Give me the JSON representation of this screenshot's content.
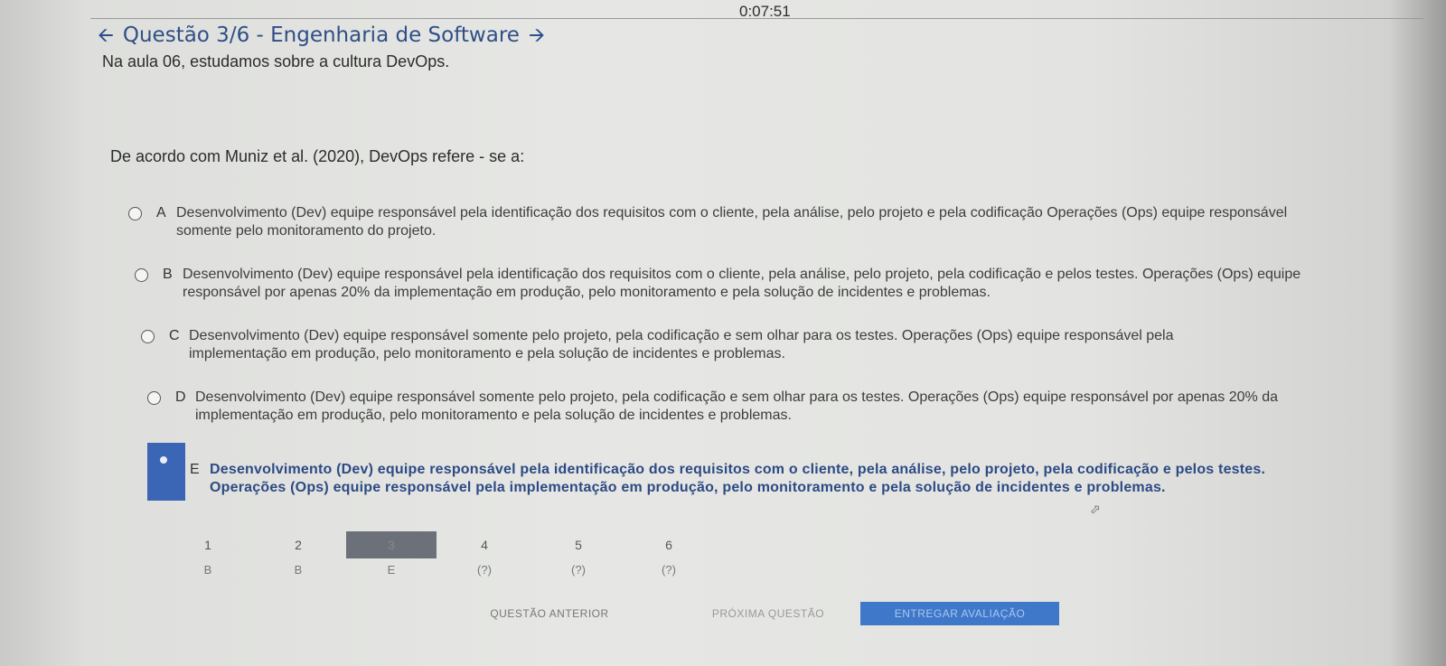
{
  "timer": "0:07:51",
  "header": {
    "title": "Questão 3/6 - Engenharia de Software",
    "prev_arrow_icon": "arrow-left-icon",
    "next_arrow_icon": "arrow-right-icon"
  },
  "intro": "Na aula 06, estudamos sobre a cultura DevOps.",
  "question": "De acordo com Muniz et al. (2020), DevOps refere - se a:",
  "options": [
    {
      "letter": "A",
      "text": "Desenvolvimento (Dev) equipe responsável pela identificação dos requisitos com o cliente, pela análise, pelo projeto e pela codificação Operações (Ops) equipe responsável somente pelo monitoramento do projeto."
    },
    {
      "letter": "B",
      "text": "Desenvolvimento (Dev) equipe responsável pela identificação dos requisitos com o cliente, pela análise, pelo projeto, pela codificação e pelos testes. Operações (Ops) equipe responsável por apenas 20% da implementação em produção, pelo monitoramento e pela solução de incidentes e problemas."
    },
    {
      "letter": "C",
      "text": "Desenvolvimento (Dev) equipe responsável somente pelo projeto, pela codificação e sem olhar para os testes. Operações (Ops) equipe responsável pela implementação em produção, pelo monitoramento e pela solução de incidentes e problemas."
    },
    {
      "letter": "D",
      "text": "Desenvolvimento (Dev) equipe responsável somente pelo projeto, pela codificação e sem olhar para os testes. Operações (Ops) equipe responsável por apenas 20% da implementação em produção, pelo monitoramento e pela solução de incidentes e problemas."
    },
    {
      "letter": "E",
      "text": "Desenvolvimento (Dev) equipe responsável pela identificação dos requisitos com o cliente, pela análise, pelo projeto, pela codificação e pelos testes. Operações (Ops) equipe responsável pela implementação em produção, pelo monitoramento e pela solução de incidentes e problemas."
    }
  ],
  "selected_option": "E",
  "question_nav": [
    {
      "number": "1",
      "answer": "B"
    },
    {
      "number": "2",
      "answer": "B"
    },
    {
      "number": "3",
      "answer": "E"
    },
    {
      "number": "4",
      "answer": "(?)"
    },
    {
      "number": "5",
      "answer": "(?)"
    },
    {
      "number": "6",
      "answer": "(?)"
    }
  ],
  "active_question": "3",
  "buttons": {
    "prev": "QUESTÃO ANTERIOR",
    "next": "PRÓXIMA QUESTÃO",
    "submit": "ENTREGAR AVALIAÇÃO"
  },
  "colors": {
    "title": "#2f4f86",
    "selected": "#3b66b5",
    "submit_button": "#3f78c9"
  }
}
